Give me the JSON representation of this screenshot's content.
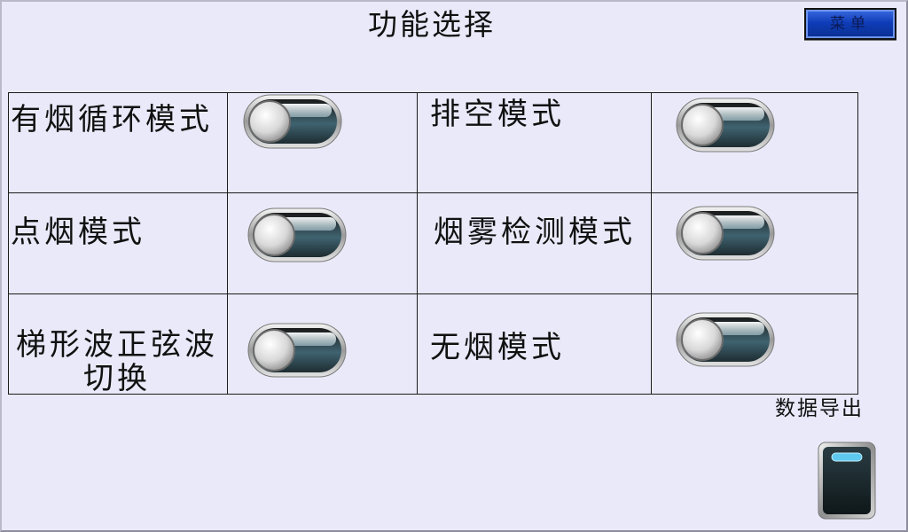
{
  "header": {
    "title": "功能选择",
    "menu_label": "菜单"
  },
  "modes": [
    {
      "label": "有烟循环模式",
      "state": "off"
    },
    {
      "label": "排空模式",
      "state": "off"
    },
    {
      "label": "点烟模式",
      "state": "off"
    },
    {
      "label": "烟雾检测模式",
      "state": "off"
    },
    {
      "label": "梯形波正弦波",
      "label_line2": "切换",
      "state": "off"
    },
    {
      "label": "无烟模式",
      "state": "off"
    }
  ],
  "export": {
    "label": "数据导出"
  },
  "colors": {
    "background": "#e9e9f9",
    "menu_button": "#1c48c8",
    "toggle_track": "#34505a",
    "export_indicator": "#5fc8ee"
  }
}
